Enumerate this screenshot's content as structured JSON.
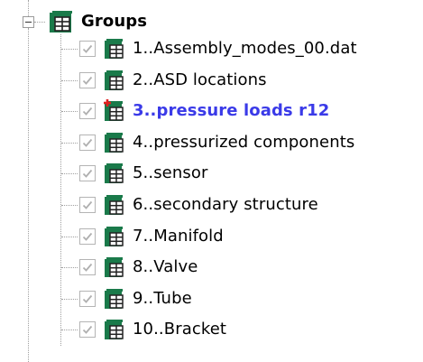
{
  "tree": {
    "root": {
      "label": "Groups",
      "icon": "group-table-icon",
      "expanded": true
    },
    "items": [
      {
        "label": "1..Assembly_modes_00.dat",
        "checked": true,
        "active": false,
        "icon": "group-table-icon"
      },
      {
        "label": "2..ASD locations",
        "checked": true,
        "active": false,
        "icon": "group-table-icon"
      },
      {
        "label": "3..pressure loads r12",
        "checked": true,
        "active": true,
        "icon": "active-group-table-icon"
      },
      {
        "label": "4..pressurized components",
        "checked": true,
        "active": false,
        "icon": "group-table-icon"
      },
      {
        "label": "5..sensor",
        "checked": true,
        "active": false,
        "icon": "group-table-icon"
      },
      {
        "label": "6..secondary structure",
        "checked": true,
        "active": false,
        "icon": "group-table-icon"
      },
      {
        "label": "7..Manifold",
        "checked": true,
        "active": false,
        "icon": "group-table-icon"
      },
      {
        "label": "8..Valve",
        "checked": true,
        "active": false,
        "icon": "group-table-icon"
      },
      {
        "label": "9..Tube",
        "checked": true,
        "active": false,
        "icon": "group-table-icon"
      },
      {
        "label": "10..Bracket",
        "checked": true,
        "active": false,
        "icon": "group-table-icon"
      }
    ]
  },
  "colors": {
    "icon_green": "#1a7a4a",
    "icon_dark": "#222222",
    "active_text": "#3a3ae8",
    "active_marker": "#e02020",
    "checkmark": "#b0b0b0"
  }
}
